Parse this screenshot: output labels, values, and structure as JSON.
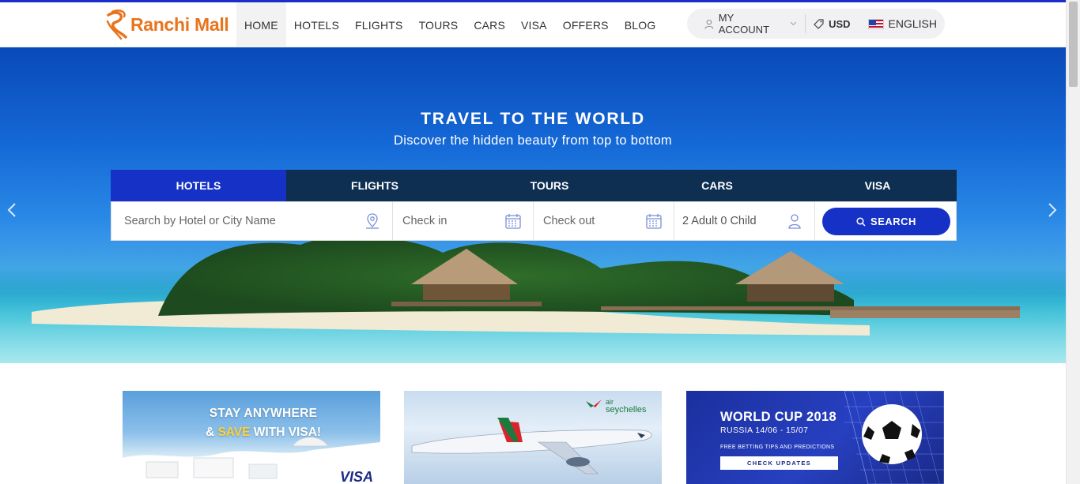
{
  "brand": {
    "name": "Ranchi Mall",
    "color": "#e8741c"
  },
  "nav": {
    "items": [
      {
        "label": "HOME"
      },
      {
        "label": "HOTELS"
      },
      {
        "label": "FLIGHTS"
      },
      {
        "label": "TOURS"
      },
      {
        "label": "CARS"
      },
      {
        "label": "VISA"
      },
      {
        "label": "OFFERS"
      },
      {
        "label": "BLOG"
      }
    ],
    "active": "HOME"
  },
  "account": {
    "my_account": "MY ACCOUNT",
    "currency": "USD",
    "language": "ENGLISH"
  },
  "hero": {
    "title": "TRAVEL TO THE WORLD",
    "subtitle": "Discover the hidden beauty from top to bottom"
  },
  "search": {
    "tabs": [
      {
        "label": "HOTELS"
      },
      {
        "label": "FLIGHTS"
      },
      {
        "label": "TOURS"
      },
      {
        "label": "CARS"
      },
      {
        "label": "VISA"
      }
    ],
    "active_tab": "HOTELS",
    "location_placeholder": "Search by Hotel or City Name",
    "checkin_placeholder": "Check in",
    "checkout_placeholder": "Check out",
    "guests": "2 Adult 0 Child",
    "button_label": "SEARCH"
  },
  "promos": {
    "visa": {
      "line1": "STAY ANYWHERE",
      "line2_prefix": "& ",
      "line2_highlight": "SAVE",
      "line2_suffix": " WITH VISA!",
      "mark": "VISA"
    },
    "airline": {
      "brand_small": "air",
      "brand": "seychelles"
    },
    "worldcup": {
      "title": "WORLD CUP 2018",
      "dates": "RUSSIA 14/06 - 15/07",
      "tips": "FREE BETTING TIPS AND PREDICTIONS",
      "button": "CHECK UPDATES"
    }
  },
  "colors": {
    "primary": "#1531c6",
    "tabbar": "#0e2f52",
    "accent": "#1a2fc9"
  },
  "icons": {
    "location": "map-pin-icon",
    "calendar": "calendar-icon",
    "user": "user-icon",
    "search": "search-icon",
    "prev": "chevron-left-icon",
    "next": "chevron-right-icon"
  }
}
